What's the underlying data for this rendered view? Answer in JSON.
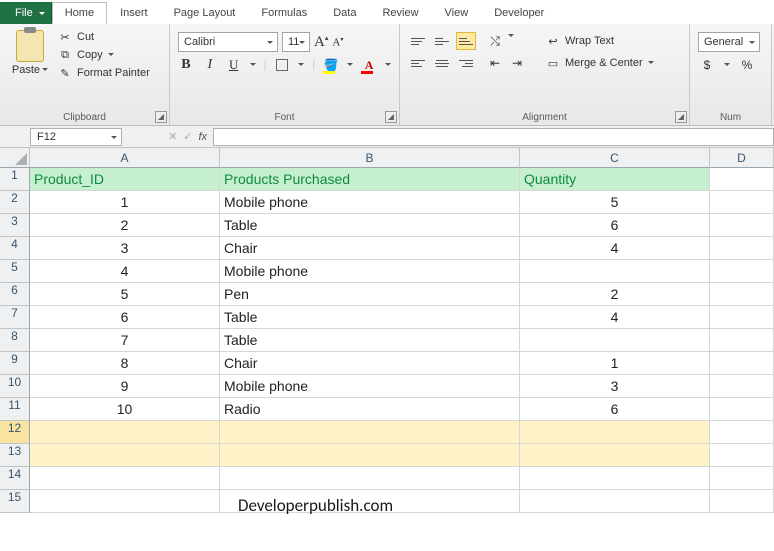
{
  "tabs": {
    "file": "File",
    "items": [
      "Home",
      "Insert",
      "Page Layout",
      "Formulas",
      "Data",
      "Review",
      "View",
      "Developer"
    ],
    "active": "Home"
  },
  "ribbon": {
    "clipboard": {
      "title": "Clipboard",
      "paste": "Paste",
      "cut": "Cut",
      "copy": "Copy",
      "format_painter": "Format Painter"
    },
    "font": {
      "title": "Font",
      "name": "Calibri",
      "size": "11"
    },
    "alignment": {
      "title": "Alignment",
      "wrap": "Wrap Text",
      "merge": "Merge & Center"
    },
    "number": {
      "title": "Num",
      "format": "General"
    }
  },
  "name_box": "F12",
  "columns": [
    "A",
    "B",
    "C",
    "D"
  ],
  "headers": {
    "a": "Product_ID",
    "b": "Products Purchased",
    "c": "Quantity"
  },
  "rows": [
    {
      "id": "1",
      "product": "Mobile phone",
      "qty": "5"
    },
    {
      "id": "2",
      "product": "Table",
      "qty": "6"
    },
    {
      "id": "3",
      "product": "Chair",
      "qty": "4"
    },
    {
      "id": "4",
      "product": "Mobile phone",
      "qty": ""
    },
    {
      "id": "5",
      "product": "Pen",
      "qty": "2"
    },
    {
      "id": "6",
      "product": "Table",
      "qty": "4"
    },
    {
      "id": "7",
      "product": "Table",
      "qty": ""
    },
    {
      "id": "8",
      "product": "Chair",
      "qty": "1"
    },
    {
      "id": "9",
      "product": "Mobile phone",
      "qty": "3"
    },
    {
      "id": "10",
      "product": "Radio",
      "qty": "6"
    }
  ],
  "watermark": "Developerpublish.com"
}
